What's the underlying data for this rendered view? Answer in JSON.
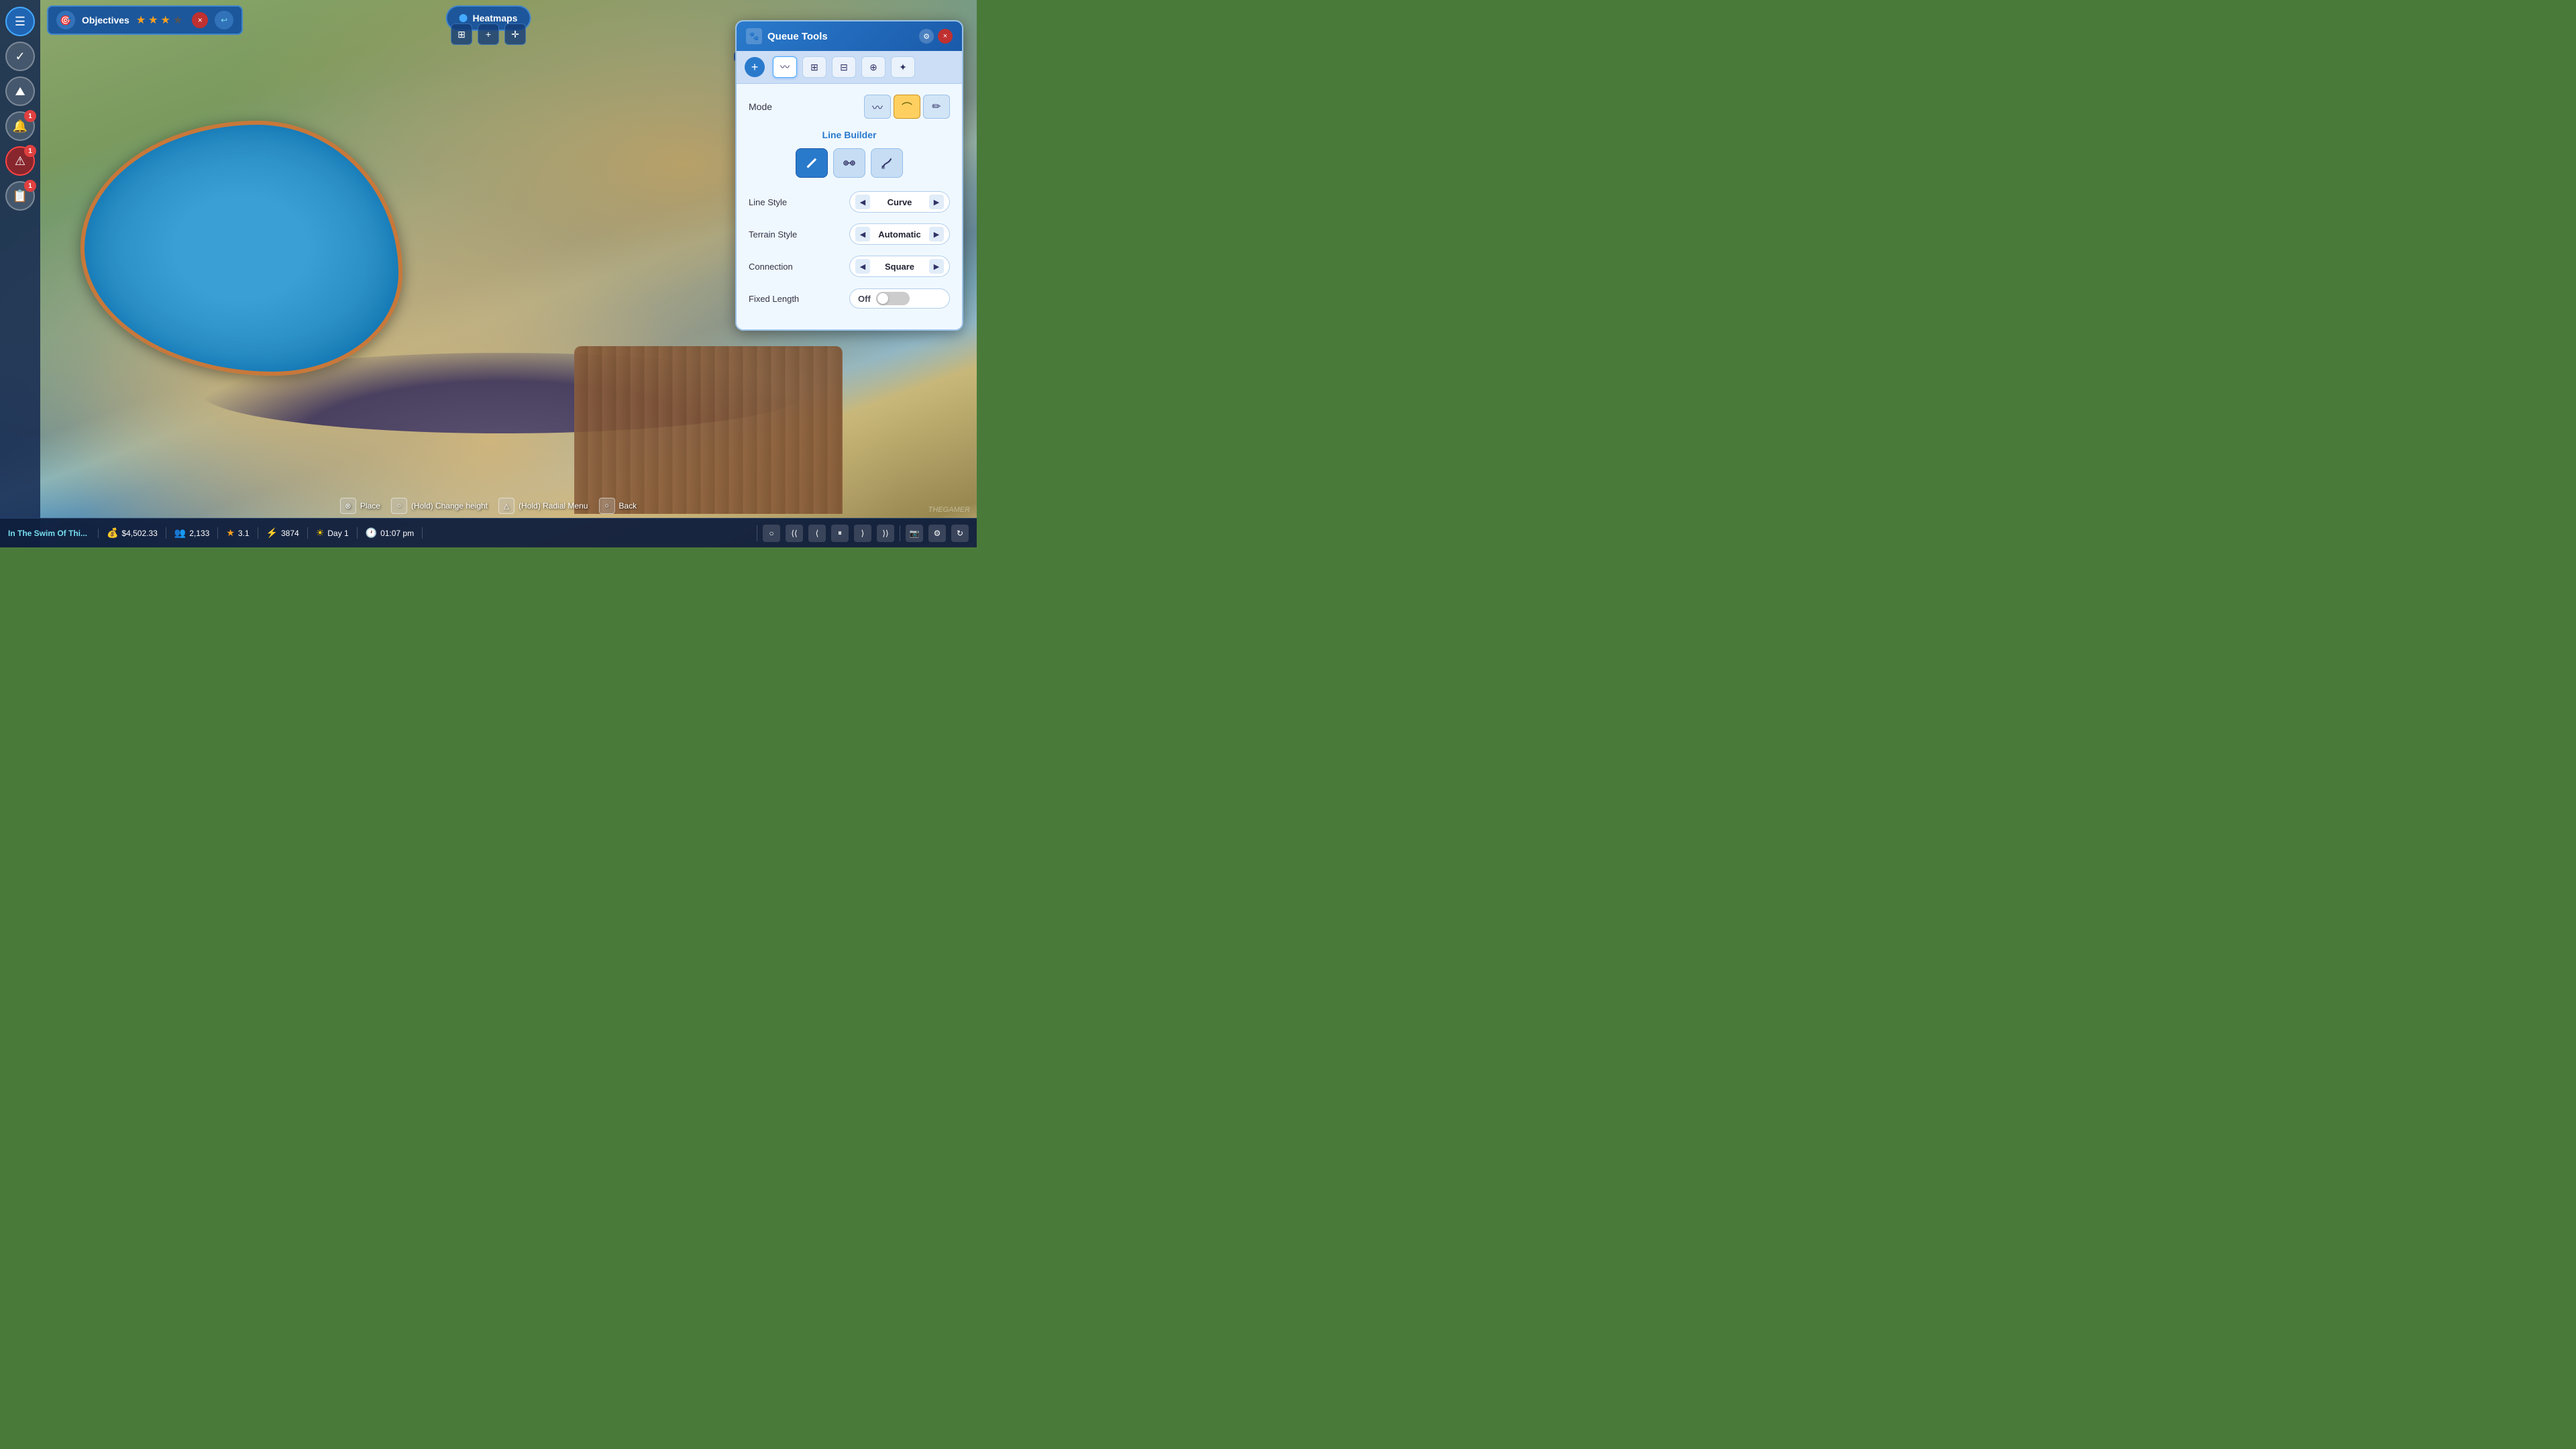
{
  "game": {
    "viewport_bg": "isometric park view with pool",
    "watermark": "THEGAMER"
  },
  "objectives": {
    "title": "Objectives",
    "stars": [
      true,
      true,
      true,
      false
    ],
    "close_label": "×",
    "extra_icon": "↩"
  },
  "heatmaps": {
    "label": "Heatmaps"
  },
  "queue_tools": {
    "title": "Queue Tools",
    "close_label": "×",
    "settings_label": "⚙",
    "mode_label": "Mode",
    "mode_options": [
      "wave",
      "curve",
      "paint"
    ],
    "line_builder_label": "Line Builder",
    "line_builder_btns": [
      "pencil",
      "chain",
      "brush"
    ],
    "line_style_label": "Line Style",
    "line_style_value": "Curve",
    "terrain_style_label": "Terrain Style",
    "terrain_style_value": "Automatic",
    "connection_label": "Connection",
    "connection_value": "Square",
    "fixed_length_label": "Fixed Length",
    "fixed_length_toggle": "Off"
  },
  "tabs": [
    {
      "icon": "+",
      "active": false
    },
    {
      "icon": "✦",
      "active": true
    },
    {
      "icon": "☰",
      "active": false
    },
    {
      "icon": "⬡",
      "active": false
    },
    {
      "icon": "⊞",
      "active": false
    }
  ],
  "status_bar": {
    "mission": "In The Swim Of Thi...",
    "money": "$4,502.33",
    "visitors": "2,133",
    "rating": "3.1",
    "happiness": "3874",
    "day": "Day 1",
    "time": "01:07 pm"
  },
  "action_hints": [
    {
      "key": "⊗",
      "label": "Place"
    },
    {
      "key": "○",
      "label": "(Hold) Change height"
    },
    {
      "key": "△",
      "label": "(Hold) Radial Menu"
    },
    {
      "key": "○",
      "label": "Back"
    }
  ],
  "playback": {
    "rewind": "⟨⟨",
    "prev": "⟨",
    "pause": "⏸",
    "next": "⟩",
    "fast": "⟩⟩",
    "camera": "📷",
    "settings": "⚙",
    "speed": "↻"
  }
}
